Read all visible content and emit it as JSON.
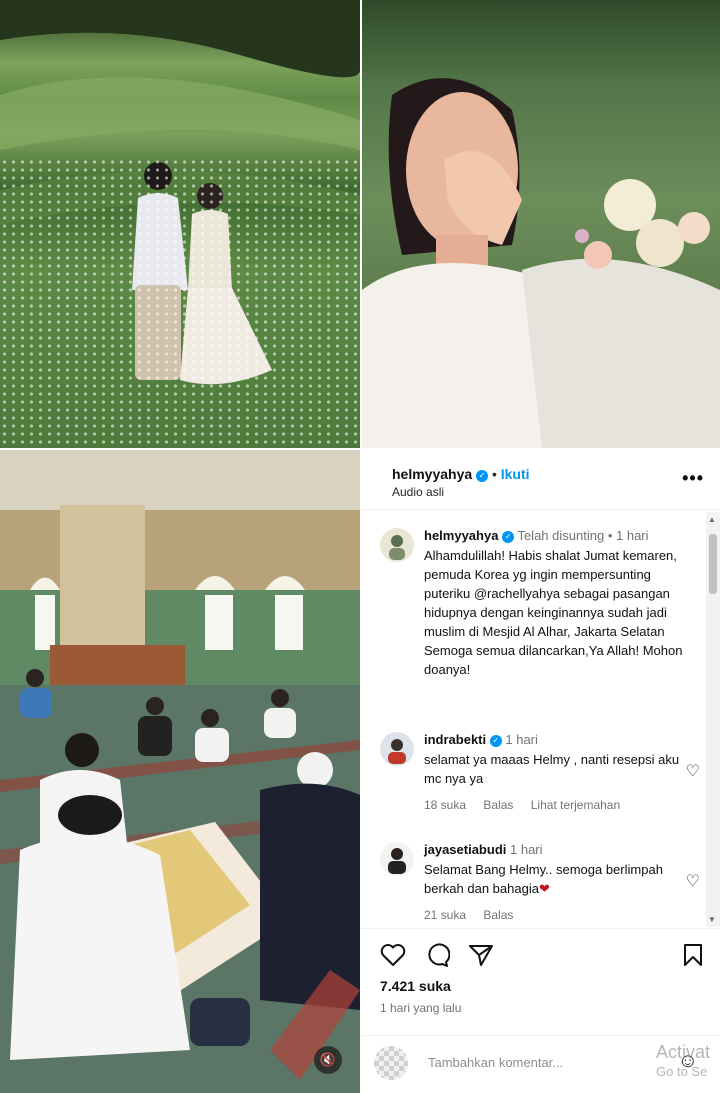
{
  "post": {
    "username": "helmyyahya",
    "follow_label": "Ikuti",
    "audio_label": "Audio asli",
    "more_label": "•••",
    "verified_mark": "✓"
  },
  "comments": [
    {
      "username": "helmyyahya",
      "edited": "Telah disunting",
      "sep": "•",
      "time": "1 hari",
      "text": "Alhamdulillah! Habis shalat Jumat kemaren, pemuda Korea yg ingin mempersunting puteriku @rachellyahya sebagai pasangan hidupnya dengan keinginannya sudah jadi muslim di Mesjid Al Alhar, Jakarta Selatan Semoga semua dilancarkan,Ya Allah! Mohon doanya!"
    },
    {
      "username": "indrabekti",
      "time": "1 hari",
      "text": "selamat ya maaas Helmy , nanti resepsi aku mc nya ya",
      "likes": "18 suka",
      "reply": "Balas",
      "translate": "Lihat terjemahan"
    },
    {
      "username": "jayasetiabudi",
      "time": "1 hari",
      "text": "Selamat Bang Helmy.. semoga berlimpah berkah dan bahagia",
      "heart": "❤",
      "likes": "21 suka",
      "reply": "Balas"
    }
  ],
  "stats": {
    "likes": "7.421 suka",
    "posted": "1 hari yang lalu"
  },
  "composer": {
    "placeholder": "Tambahkan komentar..."
  },
  "watermark": {
    "line1": "Activat",
    "line2": "Go to Se"
  },
  "icons": {
    "heart": "♡",
    "comment": "◯",
    "share": "➢",
    "bookmark": "▯",
    "emoji": "☺",
    "mute": "🔇"
  }
}
